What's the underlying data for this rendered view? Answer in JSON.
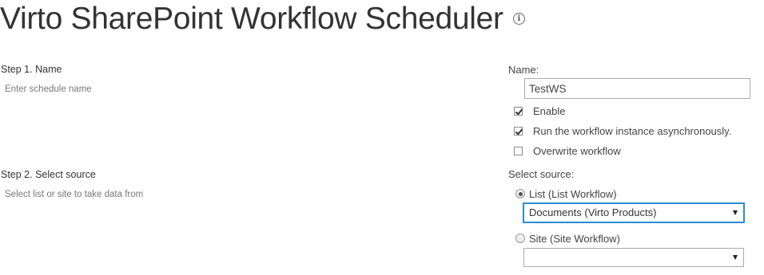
{
  "page": {
    "title": "Virto SharePoint Workflow Scheduler",
    "info_icon": "info-icon"
  },
  "step1": {
    "title": "Step 1. Name",
    "description": "Enter schedule name",
    "field_label": "Name:",
    "name_value": "TestWS",
    "options": [
      {
        "label": "Enable",
        "checked": true
      },
      {
        "label": "Run the workflow instance asynchronously.",
        "checked": true
      },
      {
        "label": "Overwrite workflow",
        "checked": false
      }
    ]
  },
  "step2": {
    "title": "Step 2. Select source",
    "description": "Select list or site to take data from",
    "field_label": "Select source:",
    "list_option": {
      "label": "List (List Workflow)",
      "selected": true,
      "dropdown_value": "Documents (Virto Products)"
    },
    "site_option": {
      "label": "Site (Site Workflow)",
      "selected": false,
      "dropdown_value": ""
    }
  },
  "colors": {
    "focus_border": "#2a8dd4",
    "title_text": "#333333",
    "muted_text": "#777777"
  }
}
